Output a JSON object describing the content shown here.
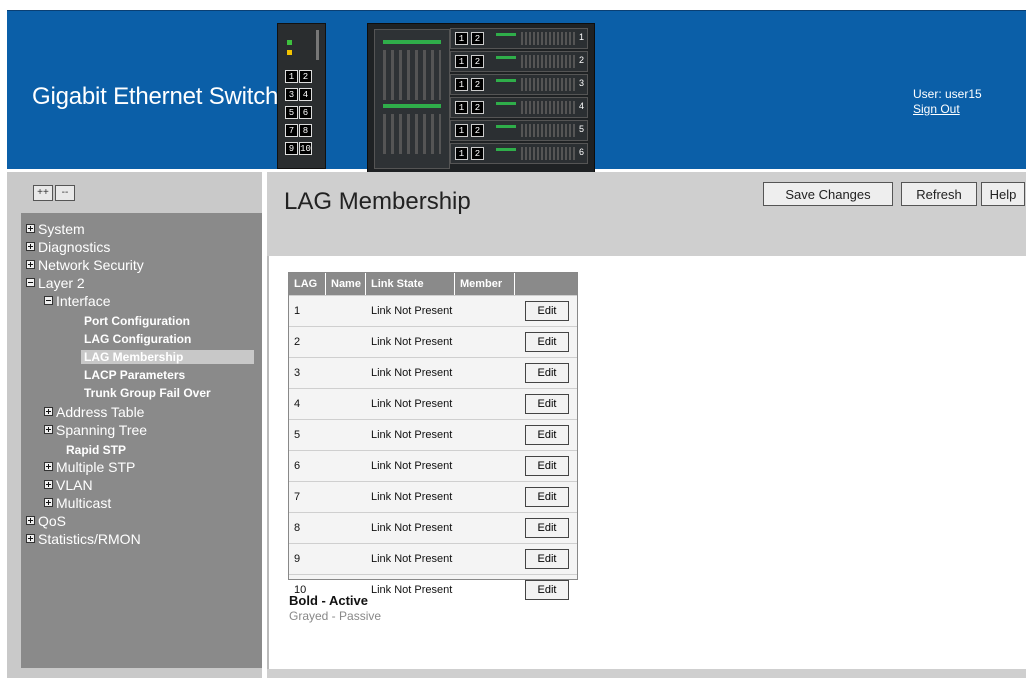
{
  "header": {
    "title": "Gigabit Ethernet Switch",
    "user_label": "User: user15",
    "signout_label": "Sign Out",
    "switch_ports": [
      "1",
      "2",
      "3",
      "4",
      "5",
      "6",
      "7",
      "8",
      "9",
      "10"
    ],
    "blades": [
      {
        "a": "1",
        "b": "2",
        "num": "1"
      },
      {
        "a": "1",
        "b": "2",
        "num": "2"
      },
      {
        "a": "1",
        "b": "2",
        "num": "3"
      },
      {
        "a": "1",
        "b": "2",
        "num": "4"
      },
      {
        "a": "1",
        "b": "2",
        "num": "5"
      },
      {
        "a": "1",
        "b": "2",
        "num": "6"
      }
    ]
  },
  "sidebar": {
    "expand_all": "++",
    "collapse_all": "--",
    "items": {
      "system": "System",
      "diagnostics": "Diagnostics",
      "network_security": "Network Security",
      "layer2": "Layer 2",
      "interface": "Interface",
      "port_configuration": "Port Configuration",
      "lag_configuration": "LAG Configuration",
      "lag_membership": "LAG Membership",
      "lacp_parameters": "LACP Parameters",
      "trunk_group_fail_over": "Trunk Group Fail Over",
      "address_table": "Address Table",
      "spanning_tree": "Spanning Tree",
      "rapid_stp": "Rapid STP",
      "multiple_stp": "Multiple STP",
      "vlan": "VLAN",
      "multicast": "Multicast",
      "qos": "QoS",
      "statistics_rmon": "Statistics/RMON"
    }
  },
  "main": {
    "page_title": "LAG Membership",
    "buttons": {
      "save": "Save Changes",
      "refresh": "Refresh",
      "help": "Help"
    },
    "table": {
      "headers": {
        "lag": "LAG",
        "name": "Name",
        "link_state": "Link State",
        "member": "Member"
      },
      "edit_label": "Edit",
      "rows": [
        {
          "lag": "1",
          "link_state": "Link Not Present"
        },
        {
          "lag": "2",
          "link_state": "Link Not Present"
        },
        {
          "lag": "3",
          "link_state": "Link Not Present"
        },
        {
          "lag": "4",
          "link_state": "Link Not Present"
        },
        {
          "lag": "5",
          "link_state": "Link Not Present"
        },
        {
          "lag": "6",
          "link_state": "Link Not Present"
        },
        {
          "lag": "7",
          "link_state": "Link Not Present"
        },
        {
          "lag": "8",
          "link_state": "Link Not Present"
        },
        {
          "lag": "9",
          "link_state": "Link Not Present"
        },
        {
          "lag": "10",
          "link_state": "Link Not Present"
        }
      ]
    },
    "legend": {
      "bold": "Bold - Active",
      "gray": "Grayed - Passive"
    }
  },
  "colors": {
    "header_bg": "#0b5fa8",
    "sidebar_tree_bg": "#8a8a8a",
    "toolbar_bg": "#cfcfcf"
  }
}
